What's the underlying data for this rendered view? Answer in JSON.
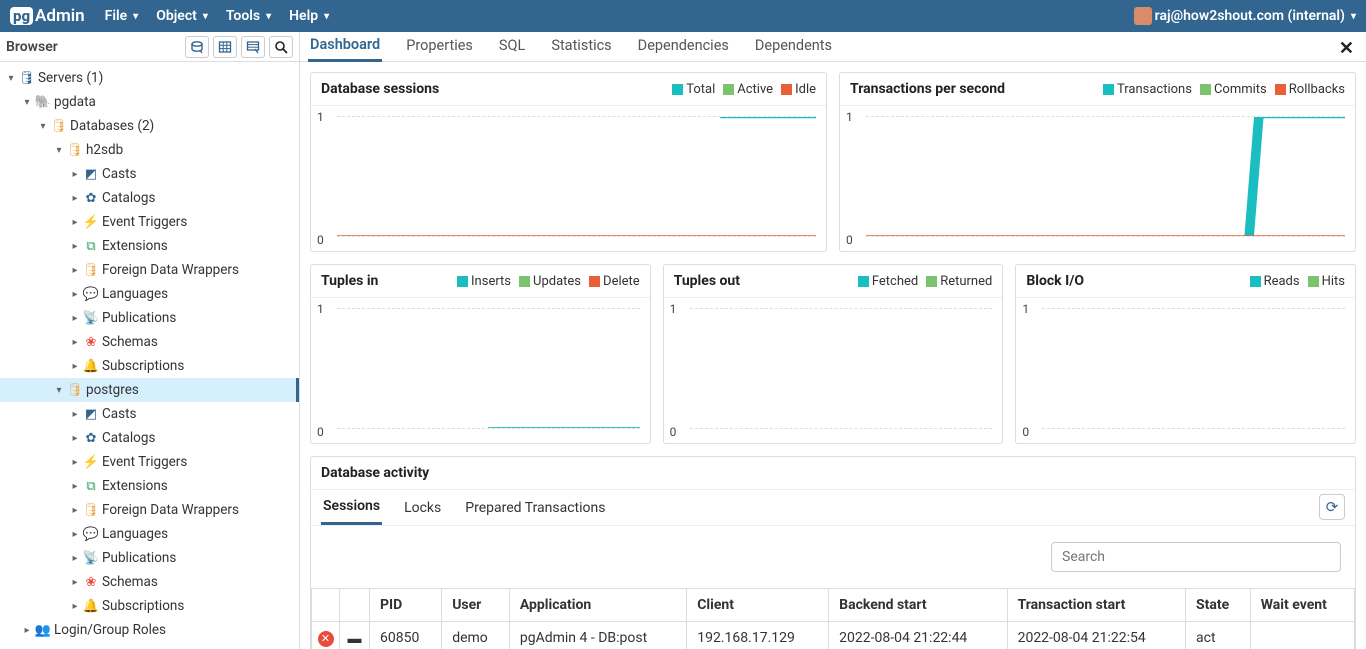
{
  "brand": {
    "pg": "pg",
    "admin": "Admin"
  },
  "menu": [
    "File",
    "Object",
    "Tools",
    "Help"
  ],
  "user": "raj@how2shout.com (internal)",
  "browser": {
    "title": "Browser",
    "nodes": [
      {
        "d": 1,
        "exp": "down",
        "ico": "🛢",
        "cls": "c-server",
        "label": "Servers (1)"
      },
      {
        "d": 2,
        "exp": "down",
        "ico": "🐘",
        "cls": "c-ele",
        "label": "pgdata"
      },
      {
        "d": 3,
        "exp": "down",
        "ico": "🛢",
        "cls": "c-db",
        "label": "Databases (2)"
      },
      {
        "d": 4,
        "exp": "down",
        "ico": "🛢",
        "cls": "c-db",
        "label": "h2sdb"
      },
      {
        "d": 5,
        "exp": "right",
        "ico": "◩",
        "cls": "c-ele",
        "label": "Casts"
      },
      {
        "d": 5,
        "exp": "right",
        "ico": "✿",
        "cls": "c-ele",
        "label": "Catalogs"
      },
      {
        "d": 5,
        "exp": "right",
        "ico": "⚡",
        "cls": "c-ele",
        "label": "Event Triggers"
      },
      {
        "d": 5,
        "exp": "right",
        "ico": "⧉",
        "cls": "c-ext",
        "label": "Extensions"
      },
      {
        "d": 5,
        "exp": "right",
        "ico": "🛢",
        "cls": "c-fdw",
        "label": "Foreign Data Wrappers"
      },
      {
        "d": 5,
        "exp": "right",
        "ico": "💬",
        "cls": "c-lang",
        "label": "Languages"
      },
      {
        "d": 5,
        "exp": "right",
        "ico": "📡",
        "cls": "c-ele",
        "label": "Publications"
      },
      {
        "d": 5,
        "exp": "right",
        "ico": "❀",
        "cls": "c-sch",
        "label": "Schemas"
      },
      {
        "d": 5,
        "exp": "right",
        "ico": "🔔",
        "cls": "c-sub",
        "label": "Subscriptions"
      },
      {
        "d": 4,
        "exp": "down",
        "ico": "🛢",
        "cls": "c-db",
        "label": "postgres",
        "sel": true
      },
      {
        "d": 5,
        "exp": "right",
        "ico": "◩",
        "cls": "c-ele",
        "label": "Casts"
      },
      {
        "d": 5,
        "exp": "right",
        "ico": "✿",
        "cls": "c-ele",
        "label": "Catalogs"
      },
      {
        "d": 5,
        "exp": "right",
        "ico": "⚡",
        "cls": "c-ele",
        "label": "Event Triggers"
      },
      {
        "d": 5,
        "exp": "right",
        "ico": "⧉",
        "cls": "c-ext",
        "label": "Extensions"
      },
      {
        "d": 5,
        "exp": "right",
        "ico": "🛢",
        "cls": "c-fdw",
        "label": "Foreign Data Wrappers"
      },
      {
        "d": 5,
        "exp": "right",
        "ico": "💬",
        "cls": "c-lang",
        "label": "Languages"
      },
      {
        "d": 5,
        "exp": "right",
        "ico": "📡",
        "cls": "c-ele",
        "label": "Publications"
      },
      {
        "d": 5,
        "exp": "right",
        "ico": "❀",
        "cls": "c-sch",
        "label": "Schemas"
      },
      {
        "d": 5,
        "exp": "right",
        "ico": "🔔",
        "cls": "c-sub",
        "label": "Subscriptions"
      },
      {
        "d": 2,
        "exp": "right",
        "ico": "👥",
        "cls": "c-roles",
        "label": "Login/Group Roles"
      }
    ]
  },
  "tabs": [
    "Dashboard",
    "Properties",
    "SQL",
    "Statistics",
    "Dependencies",
    "Dependents"
  ],
  "activeTab": 0,
  "colors": {
    "teal": "#1bbec0",
    "green": "#7bc36e",
    "orange": "#e95f36"
  },
  "charts": {
    "sessions": {
      "title": "Database sessions",
      "legend": [
        {
          "label": "Total",
          "color": "teal"
        },
        {
          "label": "Active",
          "color": "green"
        },
        {
          "label": "Idle",
          "color": "orange"
        }
      ],
      "ymin": "0",
      "ymax": "1"
    },
    "tps": {
      "title": "Transactions per second",
      "legend": [
        {
          "label": "Transactions",
          "color": "teal"
        },
        {
          "label": "Commits",
          "color": "green"
        },
        {
          "label": "Rollbacks",
          "color": "orange"
        }
      ],
      "ymin": "0",
      "ymax": "1"
    },
    "tin": {
      "title": "Tuples in",
      "legend": [
        {
          "label": "Inserts",
          "color": "teal"
        },
        {
          "label": "Updates",
          "color": "green"
        },
        {
          "label": "Delete",
          "color": "orange"
        }
      ],
      "ymin": "0",
      "ymax": "1"
    },
    "tout": {
      "title": "Tuples out",
      "legend": [
        {
          "label": "Fetched",
          "color": "teal"
        },
        {
          "label": "Returned",
          "color": "green"
        }
      ],
      "ymin": "0",
      "ymax": "1"
    },
    "bio": {
      "title": "Block I/O",
      "legend": [
        {
          "label": "Reads",
          "color": "teal"
        },
        {
          "label": "Hits",
          "color": "green"
        }
      ],
      "ymin": "0",
      "ymax": "1"
    }
  },
  "chart_data": [
    {
      "type": "line",
      "title": "Database sessions",
      "ylim": [
        0,
        1
      ],
      "x": [
        0,
        80,
        100
      ],
      "series": [
        {
          "name": "Total",
          "values": [
            null,
            1,
            1
          ]
        },
        {
          "name": "Active",
          "values": [
            0,
            0,
            0
          ]
        },
        {
          "name": "Idle",
          "values": [
            0,
            0,
            0
          ]
        }
      ]
    },
    {
      "type": "line",
      "title": "Transactions per second",
      "ylim": [
        0,
        1
      ],
      "x": [
        0,
        80,
        82,
        100
      ],
      "series": [
        {
          "name": "Transactions",
          "values": [
            null,
            null,
            1,
            1
          ]
        },
        {
          "name": "Commits",
          "values": [
            0,
            0,
            0,
            0
          ]
        },
        {
          "name": "Rollbacks",
          "values": [
            0,
            0,
            0,
            0
          ]
        }
      ]
    },
    {
      "type": "line",
      "title": "Tuples in",
      "ylim": [
        0,
        1
      ],
      "x": [
        0,
        50,
        100
      ],
      "series": [
        {
          "name": "Inserts",
          "values": [
            null,
            0,
            0
          ]
        },
        {
          "name": "Updates",
          "values": [
            null,
            0,
            0
          ]
        },
        {
          "name": "Delete",
          "values": [
            null,
            0,
            0
          ]
        }
      ]
    },
    {
      "type": "line",
      "title": "Tuples out",
      "ylim": [
        0,
        1
      ],
      "x": [
        0,
        100
      ],
      "series": [
        {
          "name": "Fetched",
          "values": [
            null,
            null
          ]
        },
        {
          "name": "Returned",
          "values": [
            null,
            null
          ]
        }
      ]
    },
    {
      "type": "line",
      "title": "Block I/O",
      "ylim": [
        0,
        1
      ],
      "x": [
        0,
        100
      ],
      "series": [
        {
          "name": "Reads",
          "values": [
            null,
            null
          ]
        },
        {
          "name": "Hits",
          "values": [
            null,
            null
          ]
        }
      ]
    }
  ],
  "activity": {
    "title": "Database activity",
    "subtabs": [
      "Sessions",
      "Locks",
      "Prepared Transactions"
    ],
    "activeSubtab": 0,
    "search_placeholder": "Search",
    "columns": [
      "",
      "",
      "PID",
      "User",
      "Application",
      "Client",
      "Backend start",
      "Transaction start",
      "State",
      "Wait event"
    ],
    "row": {
      "pid": "60850",
      "user": "demo",
      "app": "pgAdmin 4 - DB:post",
      "client": "192.168.17.129",
      "bstart": "2022-08-04 21:22:44",
      "tstart": "2022-08-04 21:22:54",
      "state": "act"
    }
  }
}
